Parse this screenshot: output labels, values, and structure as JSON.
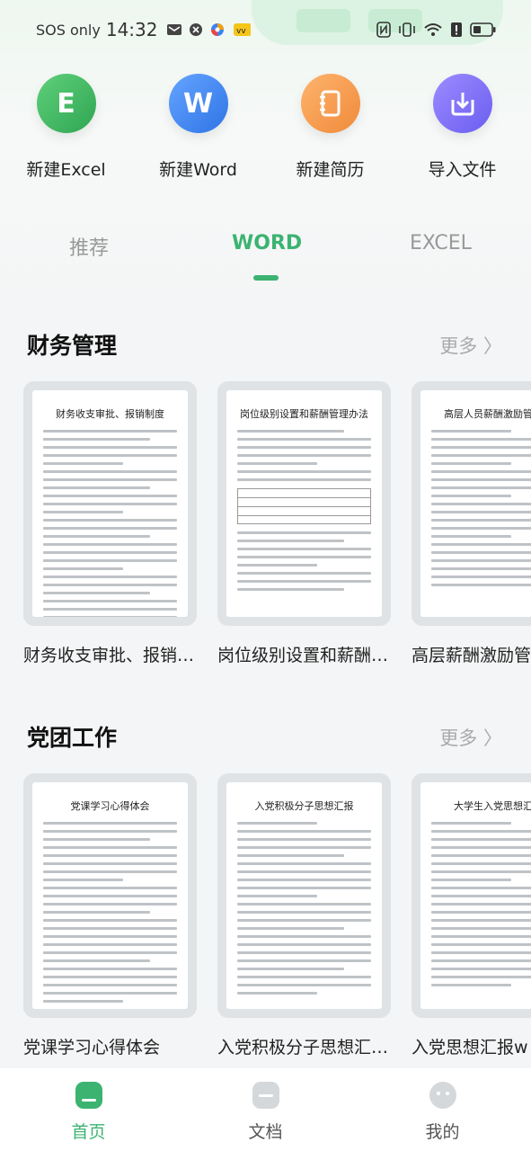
{
  "status": {
    "carrier": "SOS only",
    "time": "14:32"
  },
  "actions": [
    {
      "label": "新建Excel",
      "letter": "E",
      "icon": "excel-icon",
      "color": "#3cb05a"
    },
    {
      "label": "新建Word",
      "letter": "W",
      "icon": "word-icon",
      "color": "#3d86f0"
    },
    {
      "label": "新建简历",
      "letter": "",
      "icon": "notebook-icon",
      "color": "#f29a4a"
    },
    {
      "label": "导入文件",
      "letter": "",
      "icon": "import-icon",
      "color": "#7a6ff0"
    }
  ],
  "tabs": [
    {
      "label": "推荐",
      "active": false
    },
    {
      "label": "WORD",
      "active": true
    },
    {
      "label": "EXCEL",
      "active": false
    }
  ],
  "sections": [
    {
      "title": "财务管理",
      "more": "更多 〉",
      "cards": [
        {
          "caption": "财务收支审批、报销…",
          "doc_title": "财务收支审批、报销制度"
        },
        {
          "caption": "岗位级别设置和薪酬…",
          "doc_title": "岗位级别设置和薪酬管理办法"
        },
        {
          "caption": "高层薪酬激励管",
          "doc_title": "高层人员薪酬激励管理制"
        }
      ]
    },
    {
      "title": "党团工作",
      "more": "更多 〉",
      "cards": [
        {
          "caption": "党课学习心得体会",
          "doc_title": "党课学习心得体会"
        },
        {
          "caption": "入党积极分子思想汇…",
          "doc_title": "入党积极分子思想汇报"
        },
        {
          "caption": "入党思想汇报w",
          "doc_title": "大学生入党思想汇报"
        }
      ]
    }
  ],
  "bottom_nav": [
    {
      "label": "首页",
      "icon": "home-icon",
      "active": true
    },
    {
      "label": "文档",
      "icon": "document-icon",
      "active": false
    },
    {
      "label": "我的",
      "icon": "profile-icon",
      "active": false
    }
  ],
  "colors": {
    "accent": "#3cb371"
  }
}
